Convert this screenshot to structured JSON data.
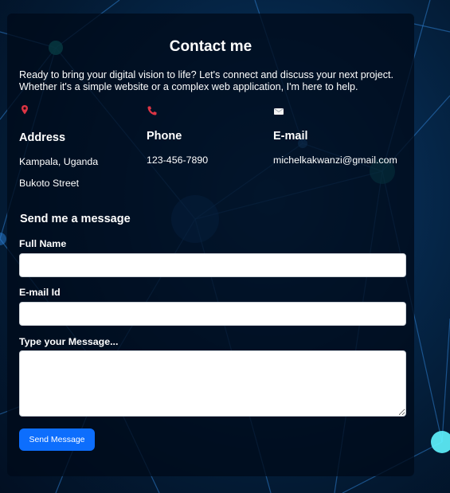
{
  "page": {
    "title": "Contact me",
    "intro": "Ready to bring your digital vision to life? Let's connect and discuss your next project. Whether it's a simple website or a complex web application, I'm here to help."
  },
  "contact": {
    "address": {
      "icon": "map-pin-icon",
      "heading": "Address",
      "line1": "Kampala, Uganda",
      "line2": "Bukoto Street"
    },
    "phone": {
      "icon": "phone-icon",
      "heading": "Phone",
      "value": "123-456-7890"
    },
    "email": {
      "icon": "envelope-icon",
      "heading": "E-mail",
      "value": "michelkakwanzi@gmail.com"
    }
  },
  "form": {
    "heading": "Send me a message",
    "full_name_label": "Full Name",
    "full_name_value": "",
    "email_label": "E-mail Id",
    "email_value": "",
    "message_label": "Type your Message...",
    "message_value": "",
    "submit_label": "Send Message"
  },
  "colors": {
    "accent": "#0d6efd",
    "icon_red": "#dc3545",
    "card_bg": "#000a19"
  }
}
